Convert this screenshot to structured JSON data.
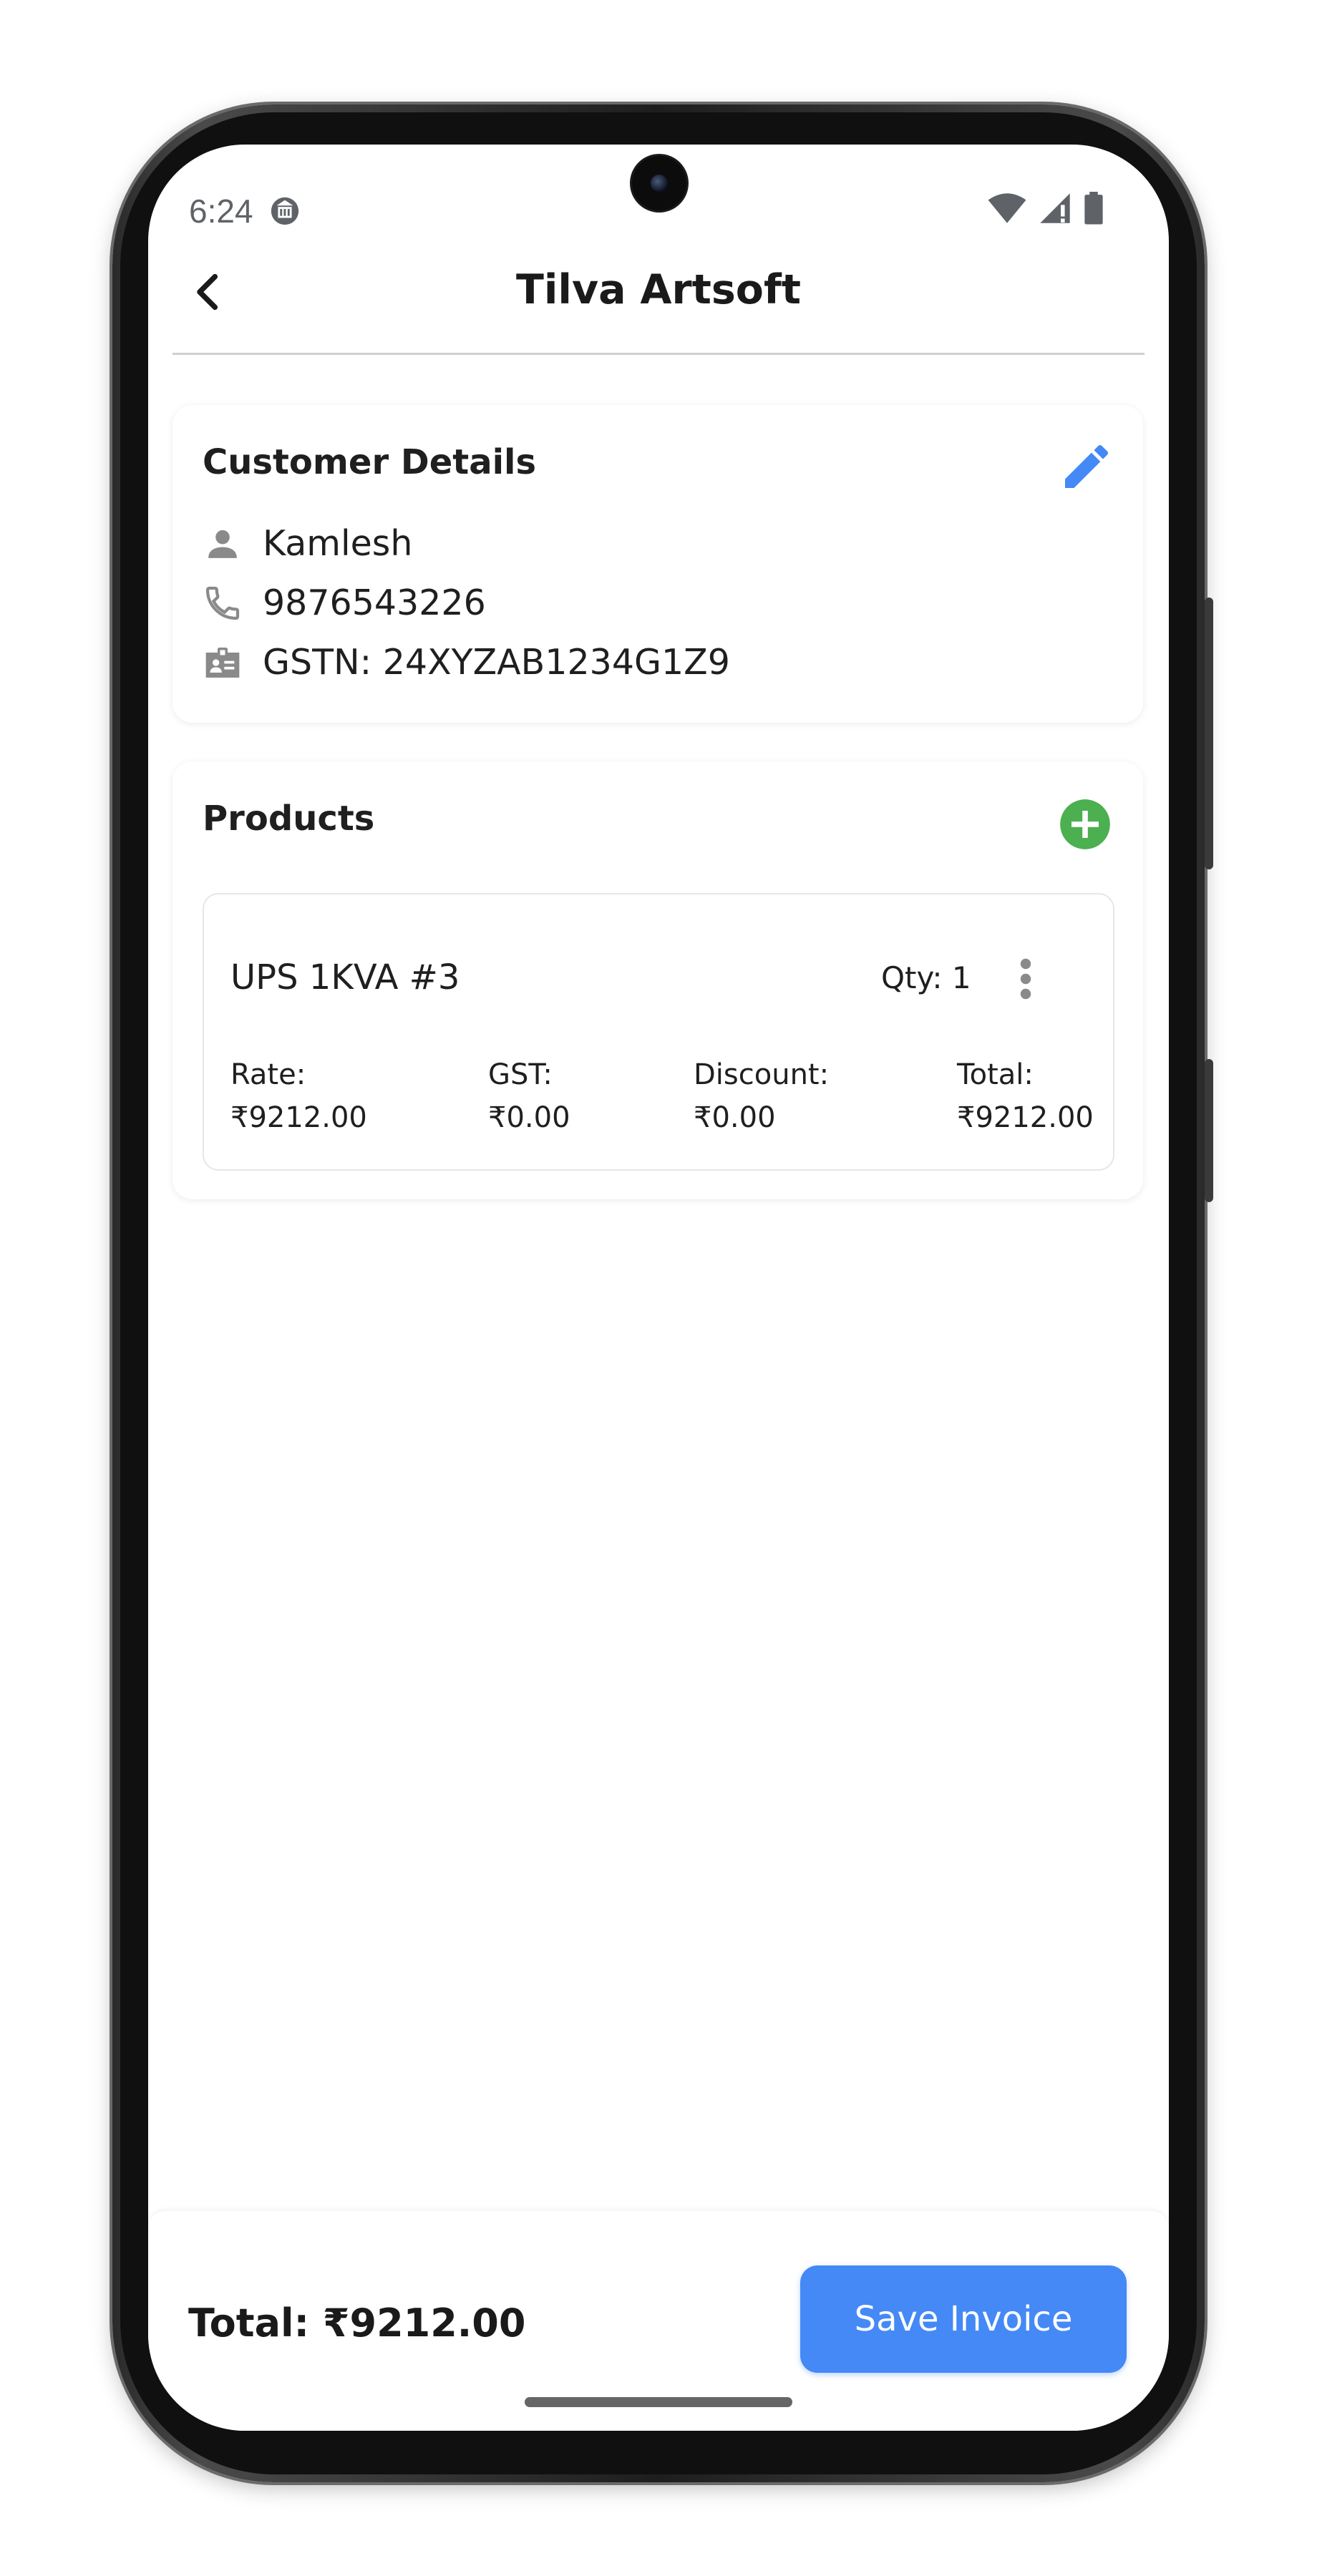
{
  "status_bar": {
    "time": "6:24",
    "notification_icon": "notification-icon",
    "wifi_icon": "wifi-icon",
    "signal_icon": "signal-icon",
    "battery_icon": "battery-icon"
  },
  "app_bar": {
    "title": "Tilva Artsoft",
    "back_icon": "chevron-left-icon"
  },
  "customer": {
    "section_title": "Customer Details",
    "name": "Kamlesh",
    "phone": "9876543226",
    "gstn": "GSTN: 24XYZAB1234G1Z9",
    "edit_icon": "pencil-icon"
  },
  "products": {
    "section_title": "Products",
    "add_icon": "add-circle-icon",
    "items": [
      {
        "name": "UPS 1KVA #3",
        "qty_label": "Qty: 1",
        "rate_label": "Rate:",
        "rate_value": "₹9212.00",
        "gst_label": "GST:",
        "gst_value": "₹0.00",
        "discount_label": "Discount:",
        "discount_value": "₹0.00",
        "total_label": "Total:",
        "total_value": "₹9212.00"
      }
    ]
  },
  "footer": {
    "total_text": "Total: ₹9212.00",
    "save_label": "Save Invoice"
  },
  "colors": {
    "accent": "#4489f6",
    "add_green": "#4caf50",
    "icon_gray": "#8a8a8a"
  }
}
